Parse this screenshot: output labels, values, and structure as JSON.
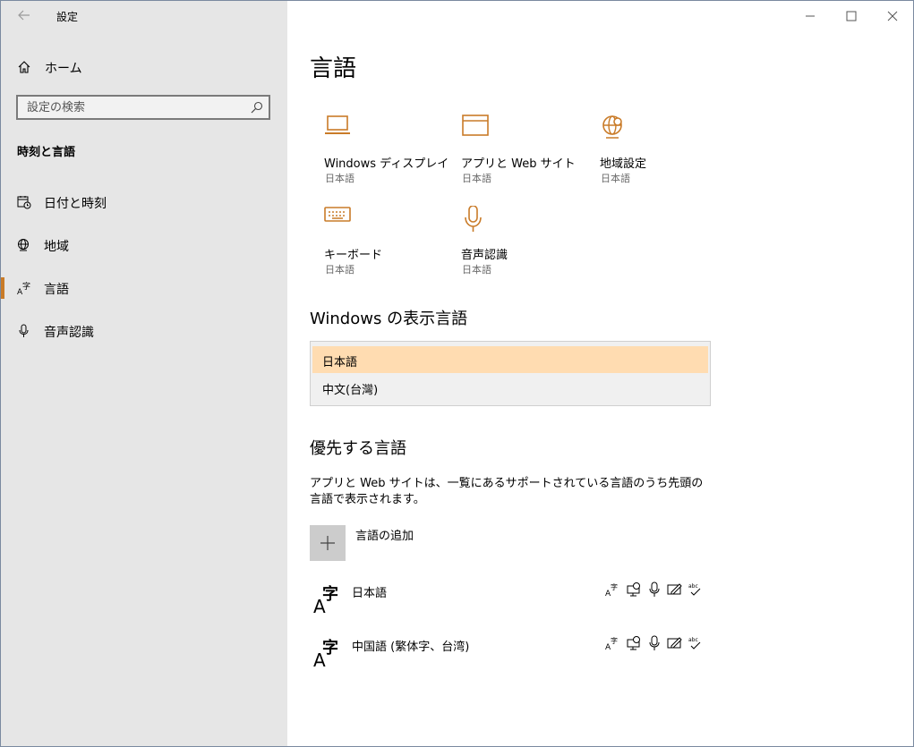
{
  "app": {
    "title": "設定"
  },
  "sidebar": {
    "home_label": "ホーム",
    "search_placeholder": "設定の検索",
    "section_heading": "時刻と言語",
    "items": [
      {
        "label": "日付と時刻",
        "icon": "calendar-clock-icon",
        "selected": false
      },
      {
        "label": "地域",
        "icon": "globe-region-icon",
        "selected": false
      },
      {
        "label": "言語",
        "icon": "language-icon",
        "selected": true
      },
      {
        "label": "音声認識",
        "icon": "microphone-icon",
        "selected": false
      }
    ]
  },
  "main": {
    "title": "言語",
    "tiles": [
      {
        "name": "Windows ディスプレイ",
        "sub": "日本語",
        "icon": "laptop-icon"
      },
      {
        "name": "アプリと Web サイト",
        "sub": "日本語",
        "icon": "browser-window-icon"
      },
      {
        "name": "地域設定",
        "sub": "日本語",
        "icon": "globe-settings-icon"
      },
      {
        "name": "キーボード",
        "sub": "日本語",
        "icon": "keyboard-icon"
      },
      {
        "name": "音声認識",
        "sub": "日本語",
        "icon": "microphone-icon"
      }
    ],
    "display_language_heading": "Windows の表示言語",
    "display_languages": [
      "日本語",
      "中文(台灣)"
    ],
    "selected_display_language": "日本語",
    "preferred_heading": "優先する言語",
    "preferred_desc": "アプリと Web サイトは、一覧にあるサポートされている言語のうち先頭の言語で表示されます。",
    "add_language_label": "言語の追加",
    "preferred_languages": [
      {
        "name": "日本語"
      },
      {
        "name": "中国語 (繁体字、台湾)"
      }
    ],
    "feature_icons": [
      "display-language-icon",
      "text-to-speech-icon",
      "speech-recognition-icon",
      "handwriting-icon",
      "spell-check-icon"
    ]
  },
  "colors": {
    "accent": "#c97b28",
    "sidebar_bg": "#e6e6e6",
    "selected_row": "#ffdcb1"
  }
}
